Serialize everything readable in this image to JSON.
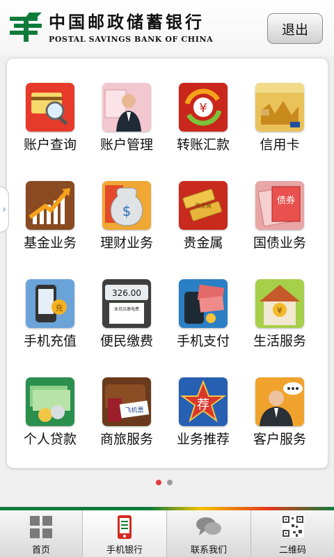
{
  "header": {
    "bank_name_cn": "中国邮政储蓄银行",
    "bank_name_en": "POSTAL SAVINGS BANK OF CHINA",
    "logo_icon": "postal-logo-icon",
    "logout_label": "退出"
  },
  "colors": {
    "brand_green": "#0e7b3a",
    "dot_active": "#e23c3c",
    "dot_inactive": "#9a9a9a"
  },
  "grid": {
    "items": [
      {
        "label": "账户查询",
        "icon": "account-query-icon"
      },
      {
        "label": "账户管理",
        "icon": "account-manage-icon"
      },
      {
        "label": "转账汇款",
        "icon": "transfer-icon"
      },
      {
        "label": "信用卡",
        "icon": "credit-card-icon"
      },
      {
        "label": "基金业务",
        "icon": "fund-icon"
      },
      {
        "label": "理财业务",
        "icon": "wealth-icon"
      },
      {
        "label": "贵金属",
        "icon": "precious-metal-icon"
      },
      {
        "label": "国债业务",
        "icon": "treasury-bond-icon"
      },
      {
        "label": "手机充值",
        "icon": "phone-recharge-icon"
      },
      {
        "label": "便民缴费",
        "icon": "bill-pay-icon"
      },
      {
        "label": "手机支付",
        "icon": "mobile-pay-icon"
      },
      {
        "label": "生活服务",
        "icon": "life-service-icon"
      },
      {
        "label": "个人贷款",
        "icon": "personal-loan-icon"
      },
      {
        "label": "商旅服务",
        "icon": "travel-icon"
      },
      {
        "label": "业务推荐",
        "icon": "recommend-icon"
      },
      {
        "label": "客户服务",
        "icon": "customer-service-icon"
      }
    ],
    "icon_texts": {
      "yen": "¥",
      "bill_amount": "326.00",
      "bill_unit": "元",
      "bill_note": "本月应缴电费",
      "ticket": "飞机票",
      "recommend": "荐",
      "bond": "债券",
      "gold": "贵金属",
      "recharge": "充"
    }
  },
  "pager": {
    "total_pages": 2,
    "current_page": 1
  },
  "bottom_nav": {
    "items": [
      {
        "label": "首页",
        "icon": "home-grid-icon"
      },
      {
        "label": "手机银行",
        "icon": "mobile-bank-icon"
      },
      {
        "label": "联系我们",
        "icon": "chat-icon"
      },
      {
        "label": "二维码",
        "icon": "qr-code-icon"
      }
    ],
    "active_index": 1
  }
}
